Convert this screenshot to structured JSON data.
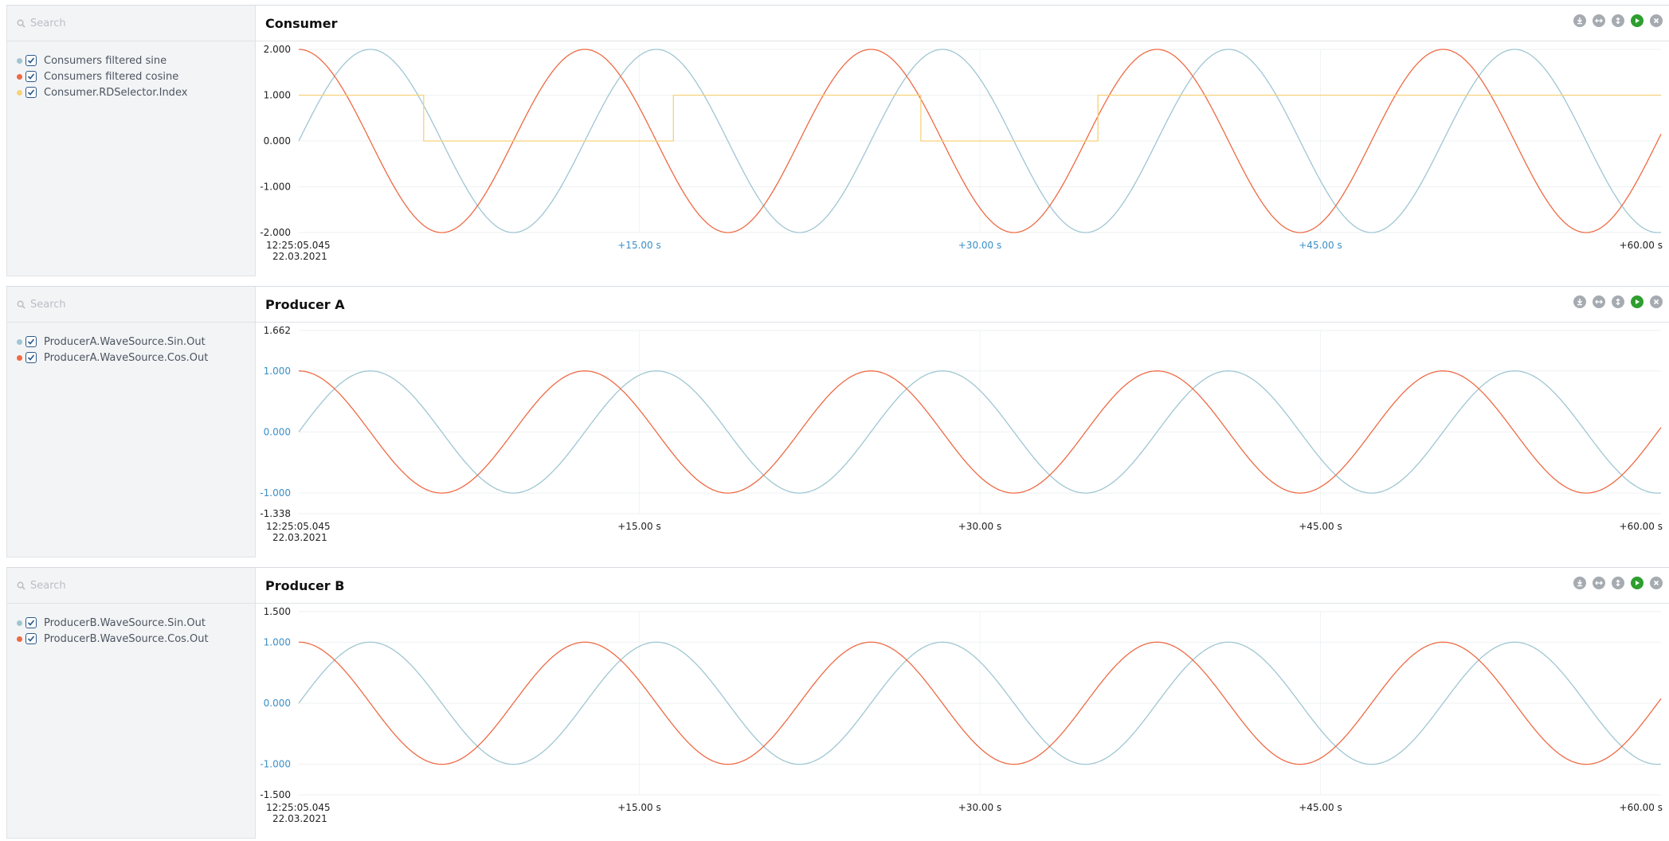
{
  "colors": {
    "sine": "#9fc6d2",
    "cosine": "#ee6a44",
    "selector": "#f6d27a",
    "tick_blue": "#3b8fc6"
  },
  "panels": [
    {
      "title": "Consumer",
      "search_placeholder": "Search",
      "legend": [
        {
          "label": "Consumers filtered sine",
          "color": "#9fc6d2"
        },
        {
          "label": "Consumers filtered cosine",
          "color": "#ee6a44"
        },
        {
          "label": "Consumer.RDSelector.Index",
          "color": "#f6d27a"
        }
      ],
      "x_start_time": "12:25:05.045",
      "x_start_date": "22.03.2021",
      "x_ticks": [
        "+15.00 s",
        "+30.00 s",
        "+45.00 s",
        "+60.00 s"
      ],
      "y_ticks": [
        "2.000",
        "1.000",
        "0.000",
        "-1.000",
        "-2.000"
      ]
    },
    {
      "title": "Producer A",
      "search_placeholder": "Search",
      "legend": [
        {
          "label": "ProducerA.WaveSource.Sin.Out",
          "color": "#9fc6d2"
        },
        {
          "label": "ProducerA.WaveSource.Cos.Out",
          "color": "#ee6a44"
        }
      ],
      "x_start_time": "12:25:05.045",
      "x_start_date": "22.03.2021",
      "x_ticks": [
        "+15.00 s",
        "+30.00 s",
        "+45.00 s",
        "+60.00 s"
      ],
      "y_ticks": [
        "1.662",
        "1.000",
        "0.000",
        "-1.000",
        "-1.338"
      ]
    },
    {
      "title": "Producer B",
      "search_placeholder": "Search",
      "legend": [
        {
          "label": "ProducerB.WaveSource.Sin.Out",
          "color": "#9fc6d2"
        },
        {
          "label": "ProducerB.WaveSource.Cos.Out",
          "color": "#ee6a44"
        }
      ],
      "x_start_time": "12:25:05.045",
      "x_start_date": "22.03.2021",
      "x_ticks": [
        "+15.00 s",
        "+30.00 s",
        "+45.00 s",
        "+60.00 s"
      ],
      "y_ticks": [
        "1.500",
        "1.000",
        "0.000",
        "-1.000",
        "-1.500"
      ]
    }
  ],
  "chart_data": [
    {
      "type": "line",
      "title": "Consumer",
      "ylim": [
        -2.0,
        2.0
      ],
      "xlim": [
        0,
        60
      ],
      "series": [
        {
          "name": "Consumers filtered sine",
          "function": "sin",
          "amplitude": 2.0,
          "period_s": 12.6
        },
        {
          "name": "Consumers filtered cosine",
          "function": "cos",
          "amplitude": 2.0,
          "period_s": 12.6
        },
        {
          "name": "Consumer.RDSelector.Index",
          "points": [
            [
              0,
              1
            ],
            [
              5.5,
              1
            ],
            [
              5.5,
              0
            ],
            [
              16.5,
              0
            ],
            [
              16.5,
              1
            ],
            [
              27.4,
              1
            ],
            [
              27.4,
              0
            ],
            [
              35.2,
              0
            ],
            [
              35.2,
              1
            ],
            [
              60,
              1
            ]
          ]
        }
      ]
    },
    {
      "type": "line",
      "title": "Producer A",
      "ylim": [
        -1.338,
        1.662
      ],
      "xlim": [
        0,
        60
      ],
      "series": [
        {
          "name": "ProducerA.WaveSource.Sin.Out",
          "function": "sin",
          "amplitude": 1.0,
          "period_s": 12.6
        },
        {
          "name": "ProducerA.WaveSource.Cos.Out",
          "function": "cos",
          "amplitude": 1.0,
          "period_s": 12.6
        }
      ]
    },
    {
      "type": "line",
      "title": "Producer B",
      "ylim": [
        -1.5,
        1.5
      ],
      "xlim": [
        0,
        60
      ],
      "series": [
        {
          "name": "ProducerB.WaveSource.Sin.Out",
          "function": "sin",
          "amplitude": 1.0,
          "period_s": 12.6
        },
        {
          "name": "ProducerB.WaveSource.Cos.Out",
          "function": "cos",
          "amplitude": 1.0,
          "period_s": 12.6
        }
      ]
    }
  ]
}
